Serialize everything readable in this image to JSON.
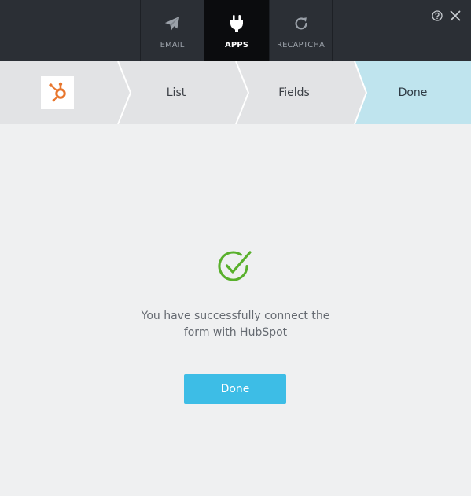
{
  "tabs": [
    {
      "label": "EMAIL",
      "icon": "paper-plane-icon",
      "active": false
    },
    {
      "label": "APPS",
      "icon": "plug-icon",
      "active": true
    },
    {
      "label": "RECAPTCHA",
      "icon": "refresh-icon",
      "active": false
    }
  ],
  "header_icons": [
    "help-icon",
    "close-icon"
  ],
  "steps": [
    {
      "label": "",
      "icon": "hubspot-logo-icon",
      "state": "complete"
    },
    {
      "label": "List",
      "state": "complete"
    },
    {
      "label": "Fields",
      "state": "complete"
    },
    {
      "label": "Done",
      "state": "current"
    }
  ],
  "main": {
    "status_icon": "check-circle-icon",
    "message_line1": "You have successfully connect the",
    "message_line2": "form with HubSpot",
    "done_button_label": "Done"
  },
  "colors": {
    "topbar": "#2b2f35",
    "active_tab": "#0b0c0e",
    "step_inactive": "#e2e3e5",
    "step_current": "#bfe4ee",
    "accent_button": "#3dbde6",
    "success_green": "#59b02c",
    "hubspot_orange": "#e8762d"
  }
}
